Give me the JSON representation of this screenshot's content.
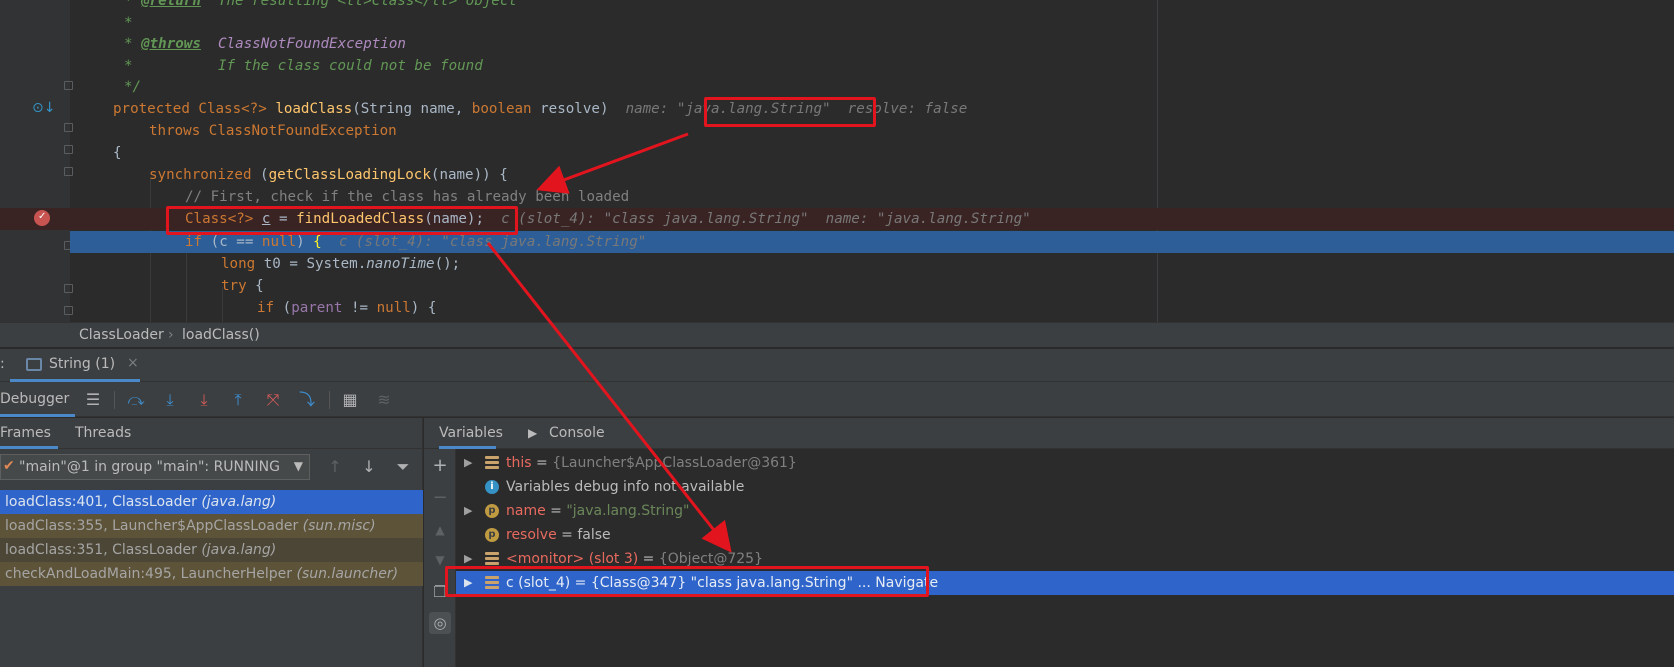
{
  "editor": {
    "lines": {
      "l0_tag": "@return",
      "l0_rest": "  The resulting <tt>Class</tt> object",
      "l1": "*",
      "l2_tag": "@throws",
      "l2_cls": "ClassNotFoundException",
      "l3": "*          If the class could not be found",
      "l4": "*/",
      "l5_kw": "protected",
      "l5_cls": "Class<?>",
      "l5_fn": "loadClass",
      "l5_p1t": "String",
      "l5_p1": "name",
      "l5_p2t": "boolean",
      "l5_p2": "resolve",
      "l5_hint_name": "name: ",
      "l5_hint_name_val": "\"java.lang.String\"",
      "l5_hint_resolve": "resolve: false",
      "l6_kw": "throws",
      "l6_cls": "ClassNotFoundException",
      "l7": "{",
      "l8_kw": "synchronized",
      "l8_fn": "getClassLoadingLock",
      "l8_arg": "name",
      "l9_comment": "// First, check if the class has already been loaded",
      "l10_cls": "Class<?>",
      "l10_var": "c",
      "l10_fn": "findLoadedClass",
      "l10_arg": "name",
      "l10_hint": "c (slot_4): \"class java.lang.String\"  name: \"java.lang.String\"",
      "l11_kw": "if",
      "l11_var": "c",
      "l11_null": "null",
      "l11_hint": "c (slot_4): \"class java.lang.String\"",
      "l12_kw": "long",
      "l12_var": "t0",
      "l12_cls": "System",
      "l12_fn": "nanoTime",
      "l13_kw": "try",
      "l14_kw": "if",
      "l14_var": "parent",
      "l14_null": "null"
    }
  },
  "breadcrumb": {
    "items": [
      "ClassLoader",
      "loadClass()"
    ],
    "separator": "›"
  },
  "session_tab": {
    "label": "String (1)",
    "close": "×"
  },
  "toolbar": {
    "debugger_label": "Debugger"
  },
  "frames": {
    "tabs": [
      "Frames",
      "Threads"
    ],
    "thread": "\"main\"@1 in group \"main\": RUNNING",
    "items": [
      {
        "method": "loadClass:401, ClassLoader ",
        "pkg": "(java.lang)"
      },
      {
        "method": "loadClass:355, Launcher$AppClassLoader ",
        "pkg": "(sun.misc)"
      },
      {
        "method": "loadClass:351, ClassLoader ",
        "pkg": "(java.lang)"
      },
      {
        "method": "checkAndLoadMain:495, LauncherHelper ",
        "pkg": "(sun.launcher)"
      }
    ]
  },
  "variables": {
    "tabs": [
      "Variables",
      "Console"
    ],
    "rows": [
      {
        "name": "this",
        "eq": " = ",
        "value": "{Launcher$AppClassLoader@361}"
      },
      {
        "name": "Variables debug info not available"
      },
      {
        "name": "name",
        "eq": " = ",
        "value": "\"java.lang.String\""
      },
      {
        "name": "resolve",
        "eq": " = ",
        "value": "false"
      },
      {
        "name": "<monitor> (slot 3)",
        "eq": " = ",
        "value": "{Object@725}"
      },
      {
        "name": "c (slot_4)",
        "eq": " = ",
        "value": "{Class@347}",
        "extra": " \"class java.lang.String\" ... Navigate"
      }
    ]
  },
  "colors": {
    "editor_bg": "#2b2b2b",
    "execution_line": "#2d5e98",
    "breakpoint_line": "#3a2323",
    "annotation_red": "#e2141e",
    "selection_blue": "#2f65ca"
  }
}
